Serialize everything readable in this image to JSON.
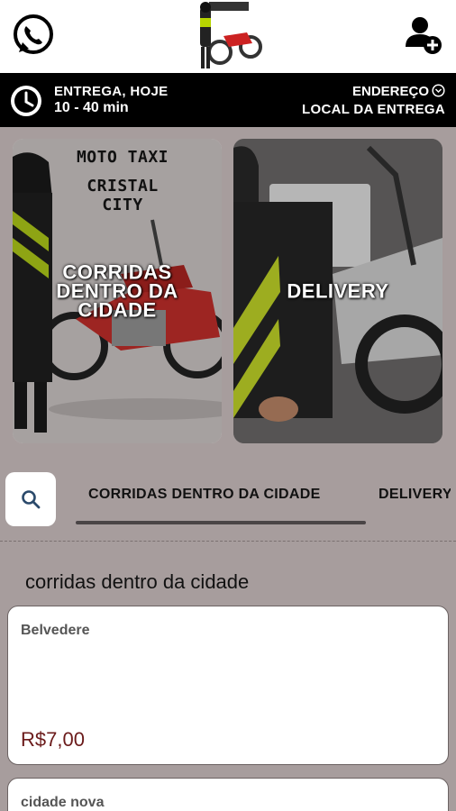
{
  "header": {
    "whatsapp_icon": "whatsapp-icon",
    "logo_icon": "motorcycle-logo",
    "account_icon": "add-user-icon"
  },
  "delivery": {
    "title": "ENTREGA, HOJE",
    "time": "10 - 40 min",
    "address_label": "ENDEREÇO",
    "address_value": "LOCAL DA ENTREGA"
  },
  "banners": [
    {
      "brand_line1": "MOTO TAXI",
      "brand_line2": "CRISTAL CITY",
      "label": "CORRIDAS\nDENTRO DA\nCIDADE"
    },
    {
      "label": "DELIVERY"
    }
  ],
  "tabs": {
    "search_icon": "search-icon",
    "items": [
      "CORRIDAS DENTRO DA CIDADE",
      "DELIVERY"
    ]
  },
  "section": {
    "title": "corridas dentro da cidade",
    "products": [
      {
        "name": "Belvedere",
        "price": "R$7,00"
      },
      {
        "name": "cidade nova",
        "price": ""
      }
    ]
  },
  "colors": {
    "background": "#a79d9d",
    "infobar": "#000000",
    "price": "#6b1b1b"
  }
}
